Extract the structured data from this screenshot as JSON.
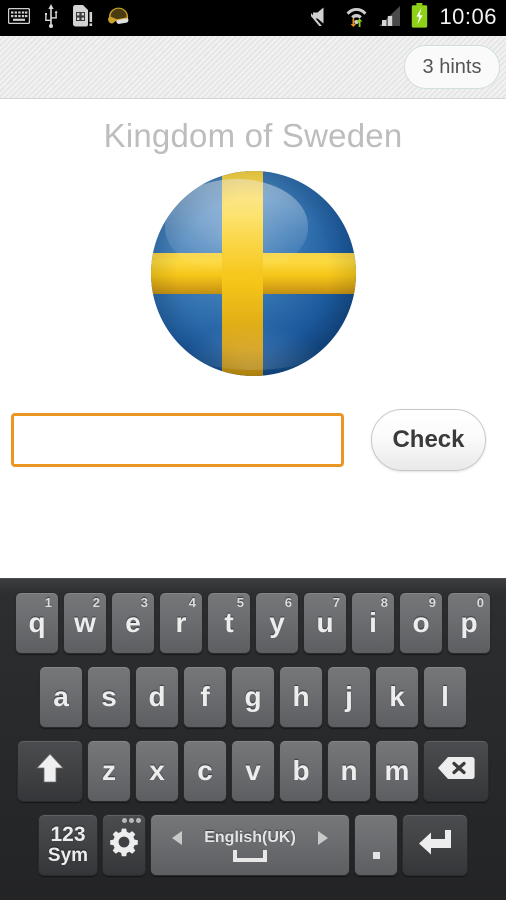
{
  "statusbar": {
    "time": "10:06",
    "left_icons": [
      {
        "name": "keyboard-icon",
        "label": "keyboard"
      },
      {
        "name": "usb-icon",
        "label": "usb"
      },
      {
        "name": "sim-card-alert-icon",
        "label": "sim card"
      },
      {
        "name": "football-helmet-icon",
        "label": "helmet"
      }
    ],
    "right_icons": [
      {
        "name": "mute-icon",
        "label": "sound off"
      },
      {
        "name": "wifi-data-icon",
        "label": "wifi"
      },
      {
        "name": "signal-bars-icon",
        "label": "signal"
      },
      {
        "name": "battery-charging-icon",
        "label": "battery charging"
      }
    ],
    "battery_color": "#8fd119"
  },
  "actionbar": {
    "hints_label": "3 hints",
    "hints_border_color": "#cfe0d4"
  },
  "quiz": {
    "country_title": "Kingdom of Sweden",
    "title_color": "#bdbdbd",
    "flag": {
      "name": "sweden-flag-sphere",
      "blue": "#1c5a9e",
      "yellow": "#f5c518"
    },
    "answer_value": "",
    "answer_placeholder": "",
    "answer_border_color": "#eb9523",
    "check_label": "Check"
  },
  "keyboard": {
    "row1": [
      {
        "key": "q",
        "num": "1"
      },
      {
        "key": "w",
        "num": "2"
      },
      {
        "key": "e",
        "num": "3"
      },
      {
        "key": "r",
        "num": "4"
      },
      {
        "key": "t",
        "num": "5"
      },
      {
        "key": "y",
        "num": "6"
      },
      {
        "key": "u",
        "num": "7"
      },
      {
        "key": "i",
        "num": "8"
      },
      {
        "key": "o",
        "num": "9"
      },
      {
        "key": "p",
        "num": "0"
      }
    ],
    "row2": [
      {
        "key": "a"
      },
      {
        "key": "s"
      },
      {
        "key": "d"
      },
      {
        "key": "f"
      },
      {
        "key": "g"
      },
      {
        "key": "h"
      },
      {
        "key": "j"
      },
      {
        "key": "k"
      },
      {
        "key": "l"
      }
    ],
    "row3": [
      {
        "key": "z"
      },
      {
        "key": "x"
      },
      {
        "key": "c"
      },
      {
        "key": "v"
      },
      {
        "key": "b"
      },
      {
        "key": "n"
      },
      {
        "key": "m"
      }
    ],
    "shift_label": "",
    "delete_label": "",
    "sym_line1": "123",
    "sym_line2": "Sym",
    "settings_label": "",
    "space_language": "English(UK)",
    "period_label": ".",
    "enter_label": ""
  }
}
